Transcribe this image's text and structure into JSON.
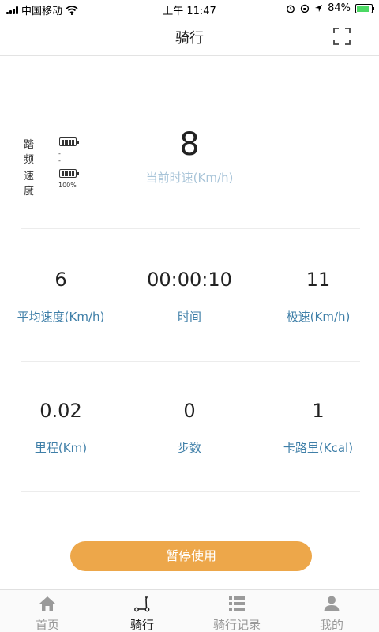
{
  "status_bar": {
    "carrier": "中国移动",
    "time": "上午 11:47",
    "battery_percent": "84%",
    "battery_level": 0.84
  },
  "nav": {
    "title": "骑行",
    "fullscreen_icon": "fullscreen-icon"
  },
  "indicators": {
    "cadence": {
      "label": "踏频",
      "value": "--"
    },
    "speed": {
      "label": "速度",
      "value": "100%"
    }
  },
  "current_speed": {
    "value": "8",
    "label": "当前时速(Km/h)"
  },
  "stats_row1": [
    {
      "value": "6",
      "label": "平均速度(Km/h)"
    },
    {
      "value": "00:00:10",
      "label": "时间"
    },
    {
      "value": "11",
      "label": "极速(Km/h)"
    }
  ],
  "stats_row2": [
    {
      "value": "0.02",
      "label": "里程(Km)"
    },
    {
      "value": "0",
      "label": "步数"
    },
    {
      "value": "1",
      "label": "卡路里(Kcal)"
    }
  ],
  "pause_button": {
    "label": "暂停使用"
  },
  "tabs": [
    {
      "label": "首页",
      "icon": "home-icon",
      "active": false
    },
    {
      "label": "骑行",
      "icon": "scooter-icon",
      "active": true
    },
    {
      "label": "骑行记录",
      "icon": "list-icon",
      "active": false
    },
    {
      "label": "我的",
      "icon": "person-icon",
      "active": false
    }
  ],
  "colors": {
    "accent": "#eda74a",
    "stat_label": "#3f7fa8",
    "speed_label": "#a8c4d8"
  }
}
